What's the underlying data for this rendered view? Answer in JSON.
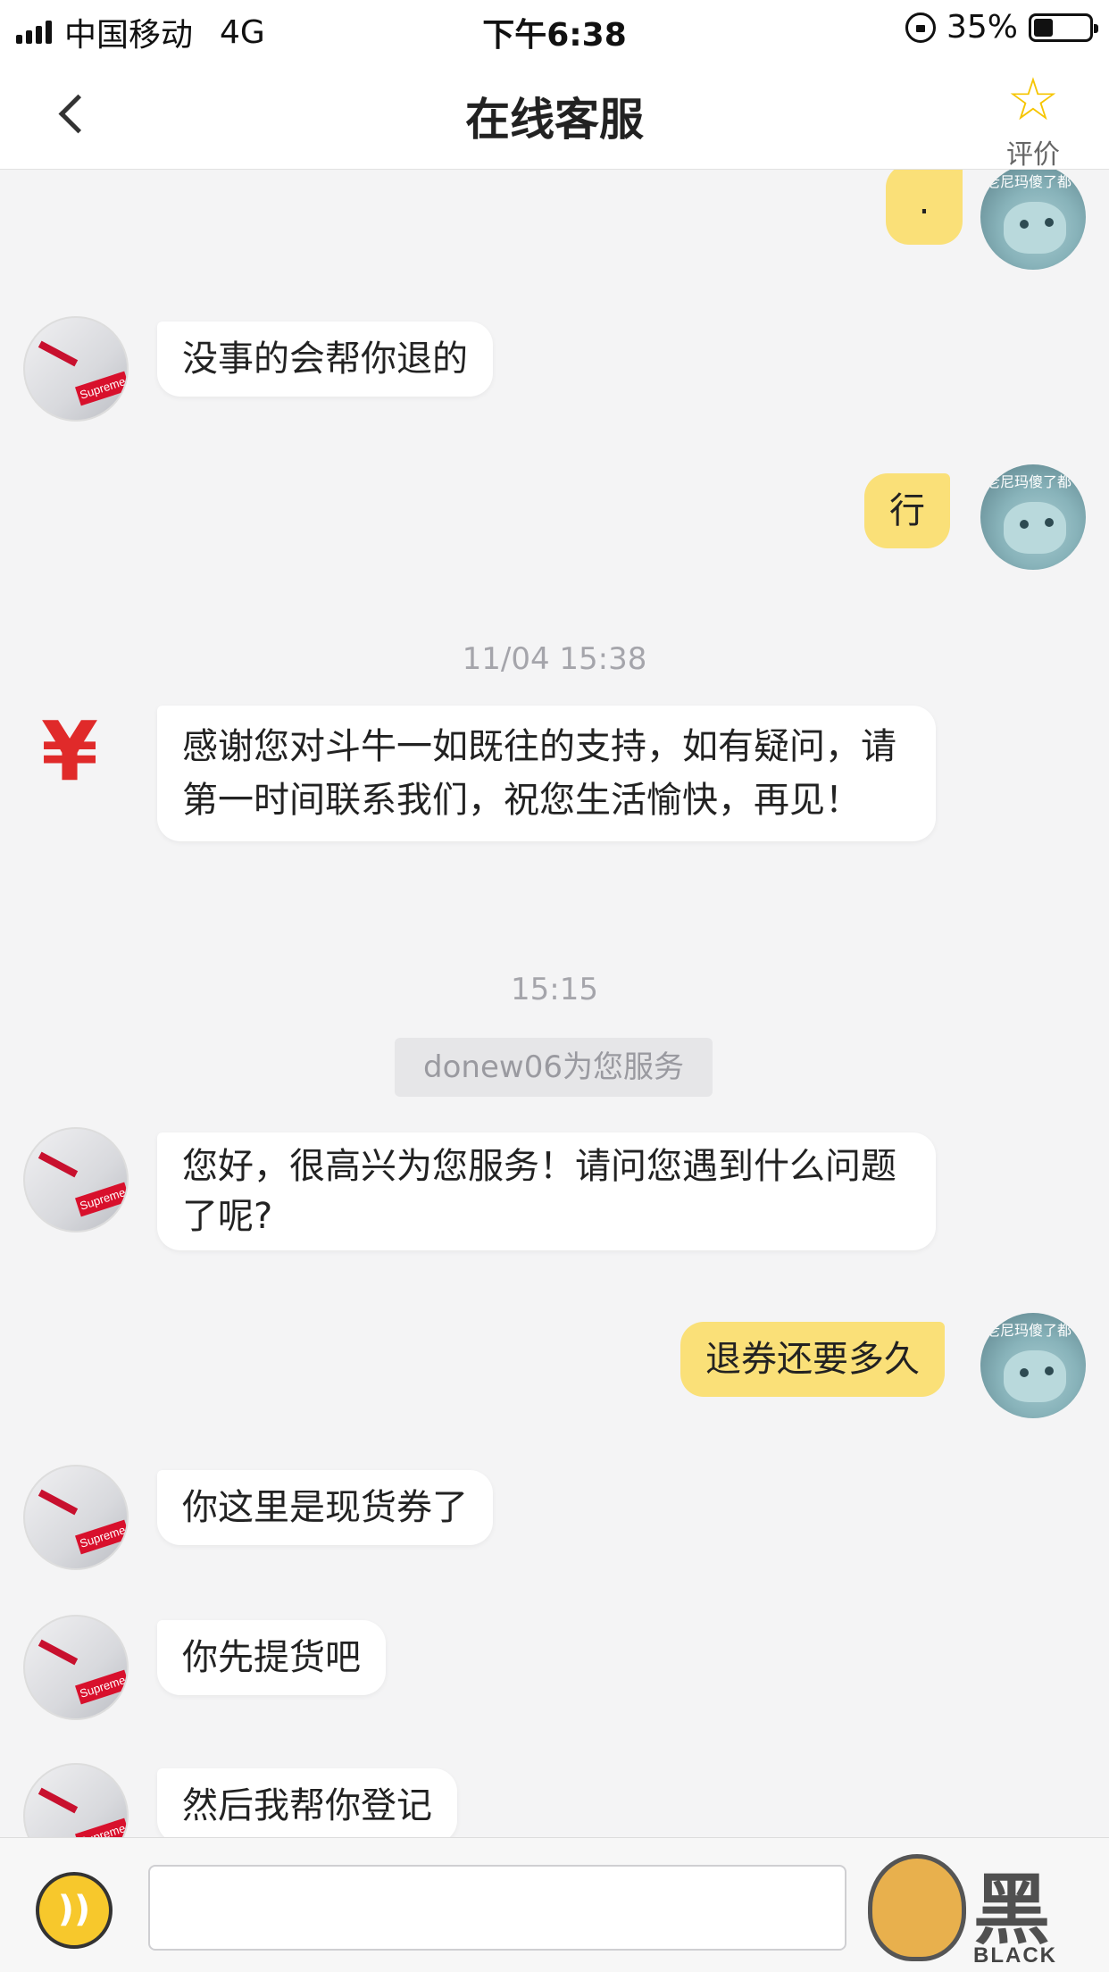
{
  "status_bar": {
    "carrier": "中国移动",
    "network": "4G",
    "time": "下午6:38",
    "battery_percent_text": "35%",
    "battery_level": 0.35
  },
  "nav": {
    "title": "在线客服",
    "rate_label": "评价",
    "rate_icon": "star-icon",
    "back_icon": "chevron-left-icon"
  },
  "user_avatar_caption": "老尼玛傻了都",
  "agent_avatar_tag": "Supreme",
  "logo_glyph": "¥",
  "messages": [
    {
      "from": "user",
      "text": "."
    },
    {
      "from": "agent",
      "text": "没事的会帮你退的"
    },
    {
      "from": "user",
      "text": "行"
    },
    {
      "type": "time",
      "text": "11/04 15:38"
    },
    {
      "from": "system-bot",
      "text": "感谢您对斗牛一如既往的支持，如有疑问，请第一时间联系我们，祝您生活愉快，再见！"
    },
    {
      "type": "time",
      "text": "15:15"
    },
    {
      "type": "notice",
      "text": "donew06为您服务"
    },
    {
      "from": "agent",
      "text": "您好，很高兴为您服务！请问您遇到什么问题了呢?"
    },
    {
      "from": "user",
      "text": "退券还要多久"
    },
    {
      "from": "agent",
      "text": "你这里是现货券了"
    },
    {
      "from": "agent",
      "text": "你先提货吧"
    },
    {
      "from": "agent",
      "text": "然后我帮你登记"
    }
  ],
  "watermark": {
    "cn": "黑猫",
    "en": "BLACK CAT"
  },
  "colors": {
    "accent": "#f6c500",
    "user_bubble": "#fae078",
    "agent_bubble": "#ffffff",
    "background": "#f4f4f5"
  }
}
